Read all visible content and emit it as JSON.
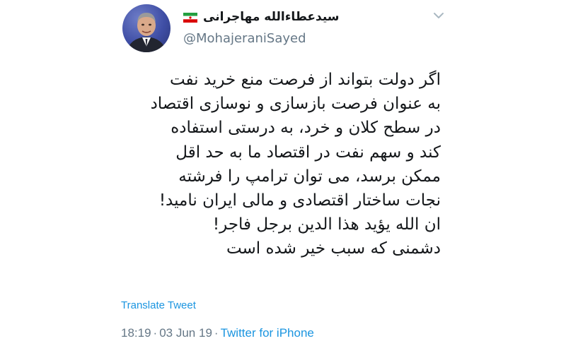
{
  "tweet": {
    "display_name": "سیدعطاءالله مهاجرانی",
    "handle": "@MohajeraniSayed",
    "lines": [
      "اگر دولت بتواند از فرصت منع خرید نفت",
      "به عنوان فرصت بازسازی و نوسازی اقتصاد",
      "در سطح کلان و خرد، به درستی استفاده",
      "کند و سهم نفت در اقتصاد ما به حد اقل",
      "ممکن برسد، می توان ترامپ را فرشته",
      "نجات ساختار اقتصادی و مالی ایران نامید!",
      "ان الله یؤید هذا الدین برجل فاجر!",
      "دشمنی که سبب خیر شده است"
    ],
    "translate_label": "Translate Tweet",
    "time": "18:19",
    "date": "03 Jun 19",
    "separator": "·",
    "source": "Twitter for iPhone"
  },
  "icons": {
    "flag": "iran-flag-icon",
    "caret": "chevron-down-icon",
    "avatar": "profile-photo"
  },
  "colors": {
    "link_blue": "#1b95e0",
    "text_dark": "#14171a",
    "text_gray": "#657786",
    "flag_green": "#239f40",
    "flag_red": "#da0000"
  }
}
